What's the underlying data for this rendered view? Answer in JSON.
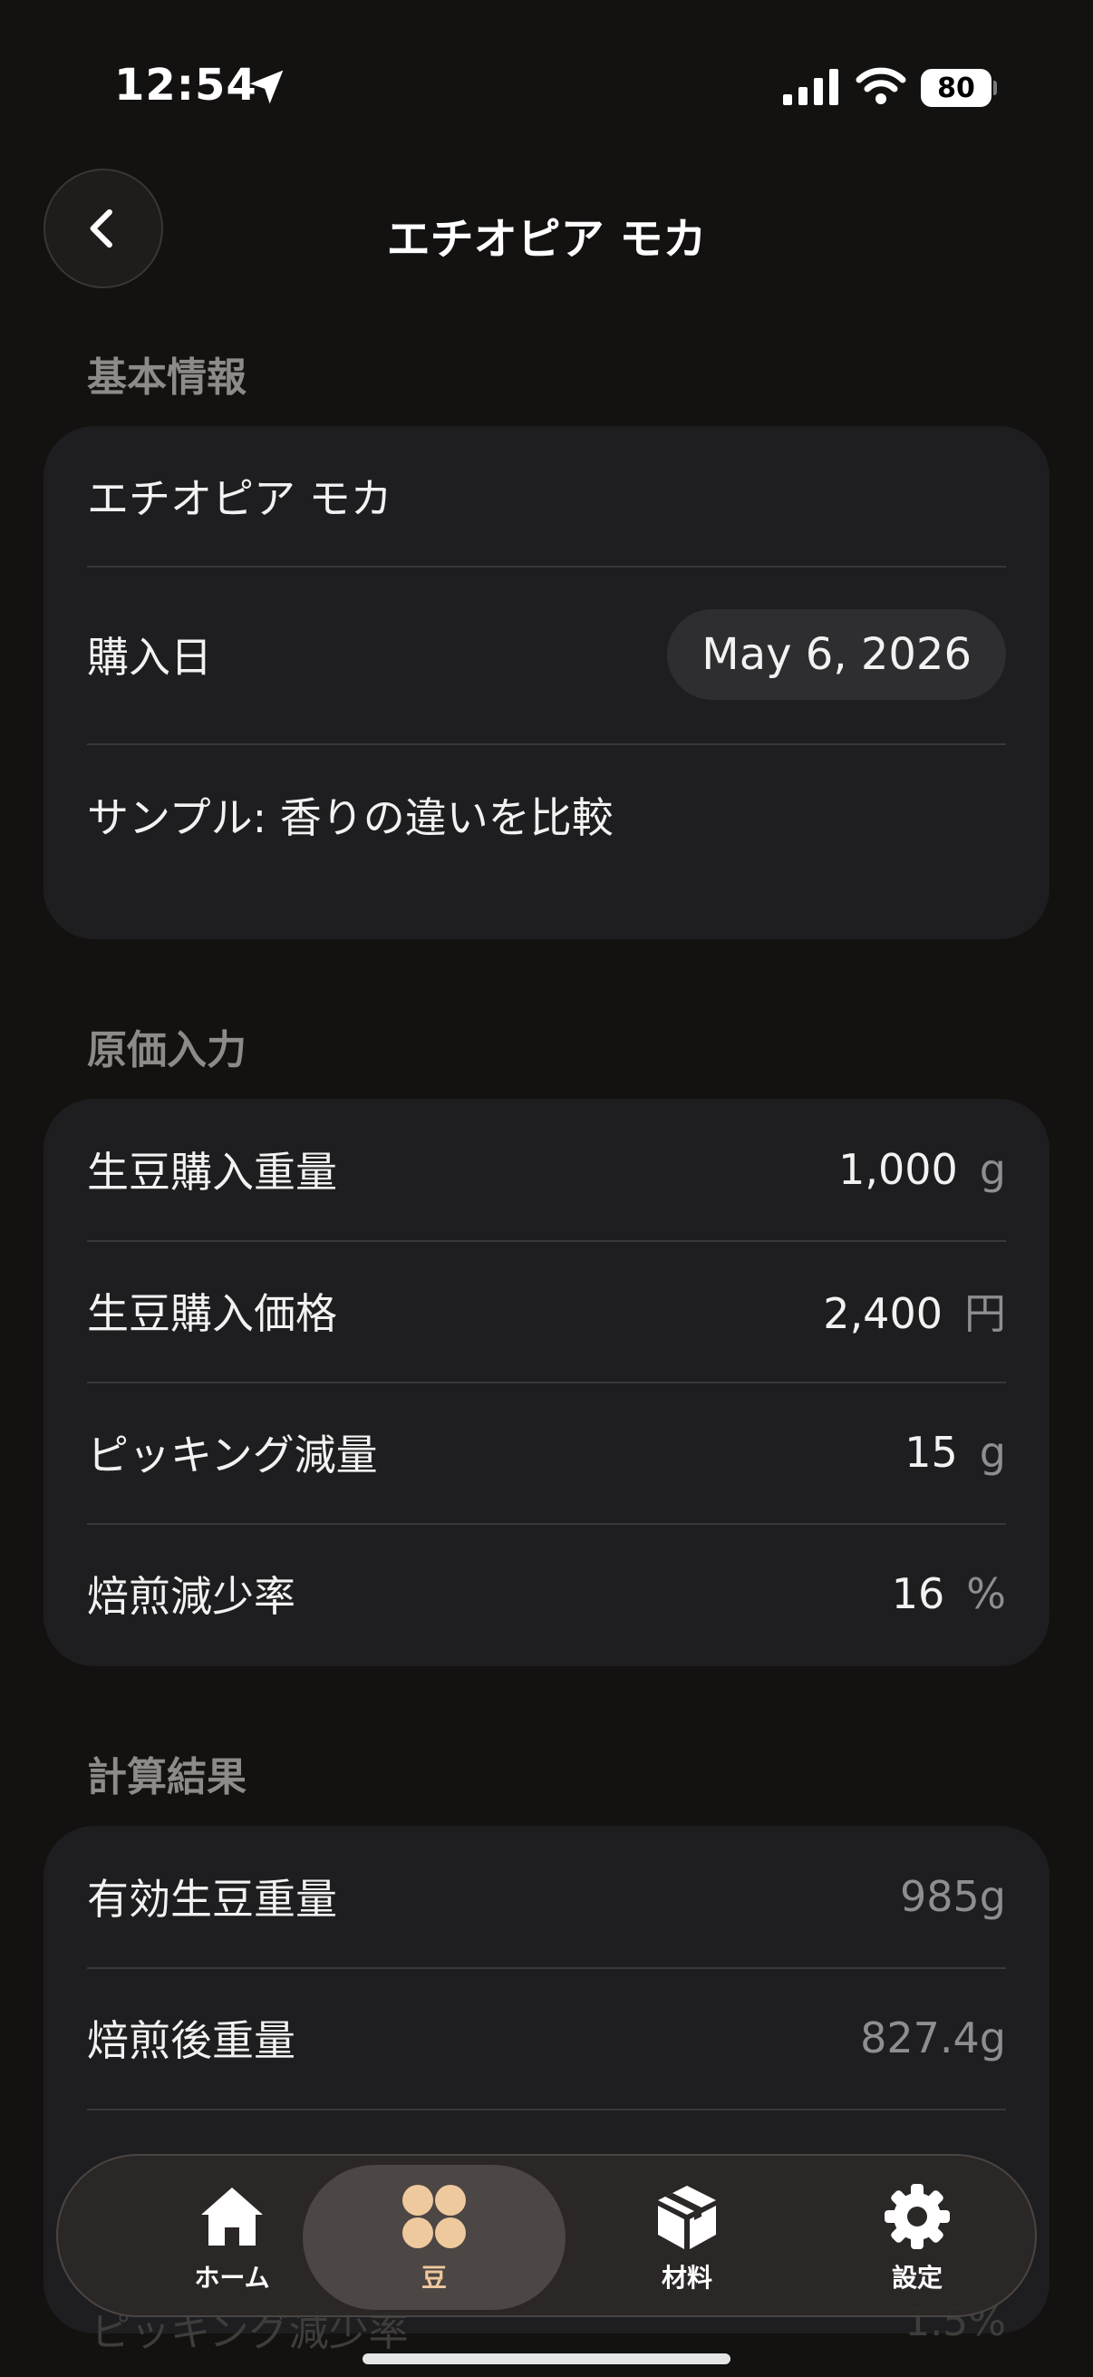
{
  "status_bar": {
    "time": "12:54",
    "battery": "80"
  },
  "header": {
    "title": "エチオピア モカ"
  },
  "basic_info": {
    "section_label": "基本情報",
    "name": "エチオピア モカ",
    "purchase_date_label": "購入日",
    "purchase_date_value": "May 6, 2026",
    "memo": "サンプル: 香りの違いを比較"
  },
  "cost_input": {
    "section_label": "原価入力",
    "rows": [
      {
        "label": "生豆購入重量",
        "value": "1,000",
        "unit": "g"
      },
      {
        "label": "生豆購入価格",
        "value": "2,400",
        "unit": "円"
      },
      {
        "label": "ピッキング減量",
        "value": "15",
        "unit": "g"
      },
      {
        "label": "焙煎減少率",
        "value": "16",
        "unit": "%"
      }
    ]
  },
  "results": {
    "section_label": "計算結果",
    "rows": [
      {
        "label": "有効生豆重量",
        "value": "985g"
      },
      {
        "label": "焙煎後重量",
        "value": "827.4g"
      }
    ],
    "peek_label": "ピッキング減少率",
    "peek_value": "1.5%"
  },
  "tabbar": {
    "tabs": [
      {
        "label": "ホーム",
        "icon": "house-icon"
      },
      {
        "label": "豆",
        "icon": "beans-icon",
        "active": true
      },
      {
        "label": "材料",
        "icon": "box-icon"
      },
      {
        "label": "設定",
        "icon": "gear-icon"
      }
    ]
  },
  "colors": {
    "background": "#141111",
    "card": "#1e1e20",
    "accent": "#efc99e"
  }
}
